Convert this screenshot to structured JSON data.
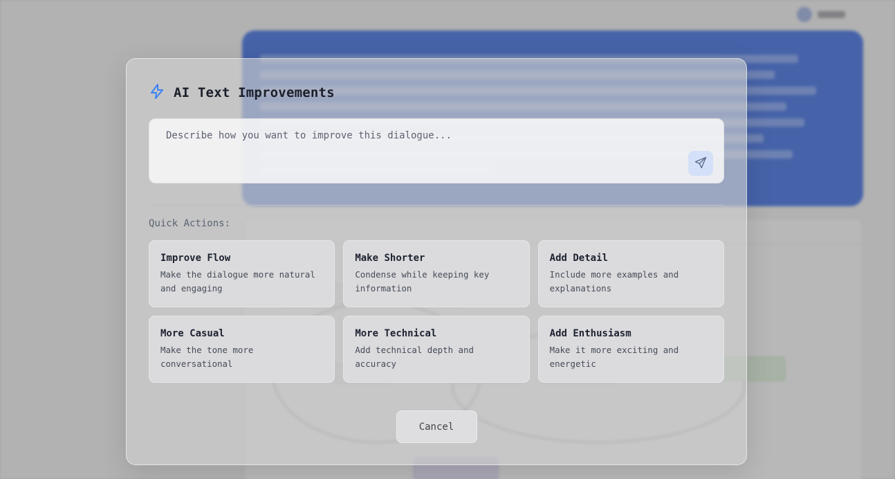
{
  "modal": {
    "title": "AI Text Improvements",
    "icon": "lightning-icon",
    "accent_color": "#3b82f6",
    "input_placeholder": "Describe how you want to improve this dialogue...",
    "quick_actions_label": "Quick Actions:",
    "quick_actions": [
      {
        "title": "Improve Flow",
        "description": "Make the dialogue more natural and engaging"
      },
      {
        "title": "Make Shorter",
        "description": "Condense while keeping key information"
      },
      {
        "title": "Add Detail",
        "description": "Include more examples and explanations"
      },
      {
        "title": "More Casual",
        "description": "Make the tone more conversational"
      },
      {
        "title": "More Technical",
        "description": "Add technical depth and accuracy"
      },
      {
        "title": "Add Enthusiasm",
        "description": "Make it more exciting and energetic"
      }
    ],
    "cancel_label": "Cancel"
  }
}
